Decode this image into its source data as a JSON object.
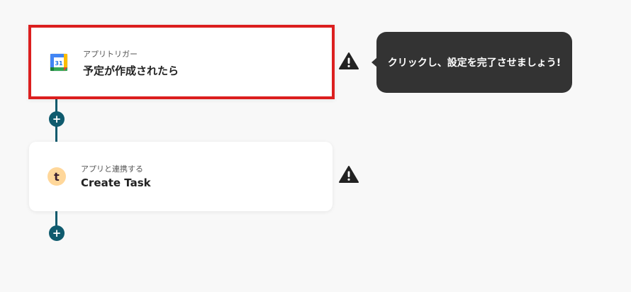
{
  "steps": [
    {
      "sub": "アプリトリガー",
      "title": "予定が作成されたら",
      "icon": "google-calendar-icon",
      "icon_text": "31"
    },
    {
      "sub": "アプリと連携する",
      "title": "Create Task",
      "icon": "task-app-icon",
      "icon_text": "t"
    }
  ],
  "tooltip": {
    "text": "クリックし、設定を完了させましょう!"
  },
  "colors": {
    "connector": "#0f5b6e",
    "highlight_border": "#dc1f1f",
    "tooltip_bg": "#333333",
    "warning": "#222222"
  }
}
